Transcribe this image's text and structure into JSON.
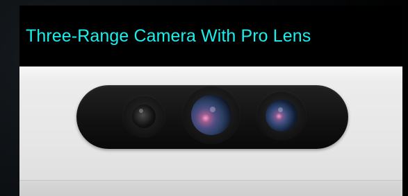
{
  "caption": {
    "text": "Three-Range Camera With Pro Lens"
  },
  "icons": [
    "camera-sensor-bar-icon",
    "camera-lens-left-icon",
    "camera-lens-center-icon",
    "camera-lens-right-icon"
  ],
  "colors": {
    "background": "#000000",
    "caption_text": "#18f0ee",
    "device_body": "#e6e6e6",
    "sensor_bar": "#121212"
  }
}
